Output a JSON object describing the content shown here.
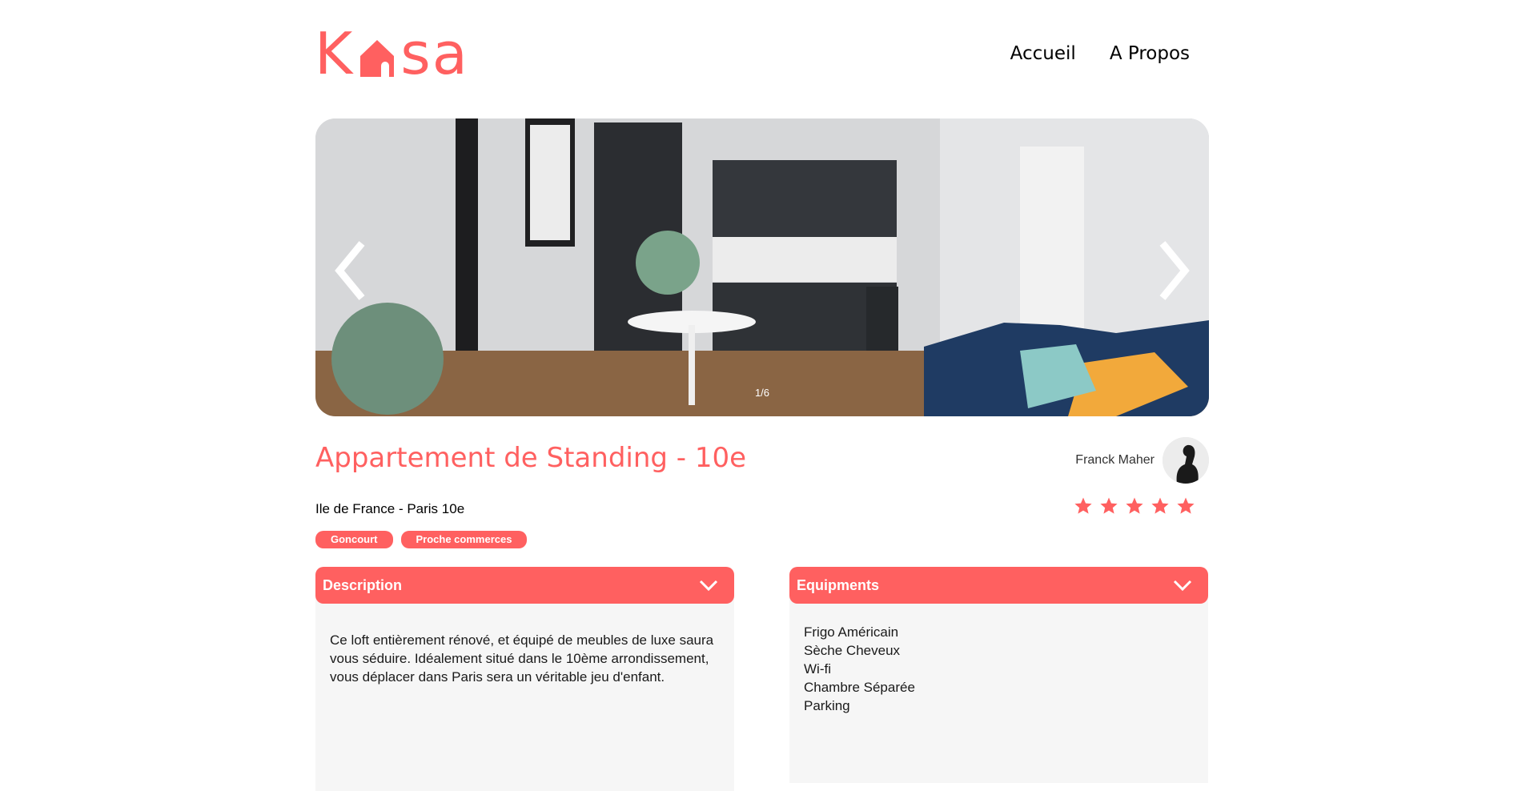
{
  "brand": {
    "logo_text_left": "K",
    "logo_text_right": "sa",
    "accent_color": "#FF6060"
  },
  "nav": {
    "items": [
      {
        "label": "Accueil"
      },
      {
        "label": "A Propos"
      }
    ]
  },
  "carousel": {
    "counter": "1/6",
    "prev_icon": "chevron-left-icon",
    "next_icon": "chevron-right-icon"
  },
  "listing": {
    "title": "Appartement de Standing - 10e",
    "location": "Ile de France - Paris 10e",
    "tags": [
      "Goncourt",
      "Proche commerces"
    ],
    "rating": 5,
    "rating_max": 5
  },
  "host": {
    "name": "Franck Maher"
  },
  "description": {
    "title": "Description",
    "text": "Ce loft entièrement rénové, et équipé de meubles de luxe saura vous séduire. Idéalement situé dans le 10ème arrondissement, vous déplacer dans Paris sera un véritable jeu d'enfant."
  },
  "equipments": {
    "title": "Equipments",
    "items": [
      "Frigo Américain",
      "Sèche Cheveux",
      "Wi-fi",
      "Chambre Séparée",
      "Parking"
    ]
  }
}
